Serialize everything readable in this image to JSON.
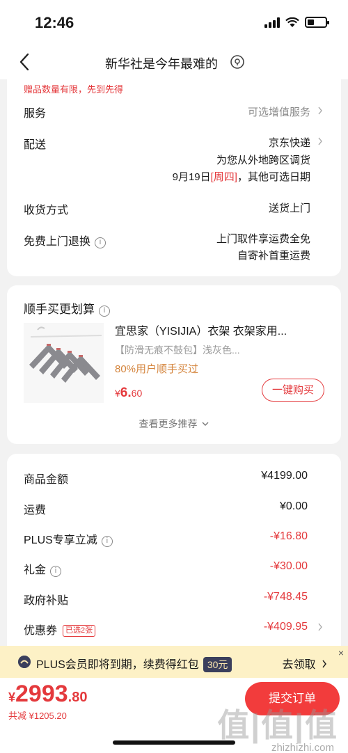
{
  "status_bar": {
    "time": "12:46"
  },
  "nav": {
    "title": "新华社是今年最难的"
  },
  "delivery_card": {
    "promo_note": "赠品数量有限，先到先得",
    "service": {
      "label": "服务",
      "value": "可选增值服务"
    },
    "shipping": {
      "label": "配送",
      "carrier": "京东快递",
      "note": "为您从外地跨区调货",
      "date_pre": "9月19日",
      "date_day": "[周四]",
      "date_post": "，其他可选日期"
    },
    "receive": {
      "label": "收货方式",
      "value": "送货上门"
    },
    "returns": {
      "label": "免费上门退换",
      "line1": "上门取件享运费全免",
      "line2": "自寄补首重运费"
    }
  },
  "recommend_card": {
    "title": "顺手买更划算",
    "product_name": "宜思家（YISIJIA）衣架 衣架家用...",
    "product_spec": "【防滑无痕不鼓包】浅灰色...",
    "product_tag": "80%用户顺手买过",
    "price_symbol": "¥",
    "price_main": "6.",
    "price_dec": "60",
    "buy_label": "一键购买",
    "more_label": "查看更多推荐"
  },
  "summary_card": {
    "rows": [
      {
        "label": "商品金额",
        "value": "¥4199.00"
      },
      {
        "label": "运费",
        "value": "¥0.00"
      },
      {
        "label": "PLUS专享立减",
        "value": "-¥16.80"
      },
      {
        "label": "礼金",
        "value": "-¥30.00"
      },
      {
        "label": "政府补贴",
        "value": "-¥748.45"
      },
      {
        "label": "优惠券",
        "badge": "已选2张",
        "value": "-¥409.95"
      }
    ]
  },
  "plus_bar": {
    "text": "PLUS会员即将到期，续费得红包",
    "amount": "30元",
    "action": "去领取",
    "close": "×"
  },
  "footer": {
    "currency": "¥",
    "total_int": "2993",
    "total_dec": ".80",
    "saved": "共减 ¥1205.20",
    "submit": "提交订单",
    "watermark": "值|值|值",
    "watermark_url": "zhizhizhi.com"
  },
  "colors": {
    "accent_red": "#e4393c",
    "plus_dark": "#3b3f5c",
    "plus_bg": "#fdf1c6",
    "tag_orange": "#d4843c"
  }
}
